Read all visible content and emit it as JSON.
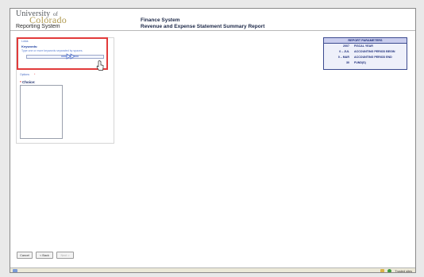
{
  "header": {
    "logo": {
      "university": "University",
      "of": "of",
      "colorado": "Colorado"
    },
    "subtitle": "Reporting System",
    "system_title": "Finance System",
    "report_title": "Revenue and Expense Statement Summary Report"
  },
  "prompt": {
    "top_link": "Lotus",
    "keywords_label": "Keywords:",
    "keywords_hint": "Type one or more keywords separated by spaces.",
    "keywords_value": "",
    "options_link": "Options",
    "choice_label": "Choice:",
    "required_marker": "*"
  },
  "report_parameters": {
    "title": "REPORT PARAMETERS",
    "rows": [
      {
        "value": "2007",
        "label": "FISCAL YEAR"
      },
      {
        "value": "0 – JUL",
        "label": "ACCOUNTING PERIOD BEGIN"
      },
      {
        "value": "0 – MAR",
        "label": "ACCOUNTING PERIOD END"
      },
      {
        "value": "30",
        "label": "FUND(S)"
      }
    ]
  },
  "footer": {
    "cancel": "Cancel",
    "back": "< Back",
    "next": "Next >"
  },
  "statusbar": {
    "zone": "Trusted sites"
  },
  "colors": {
    "highlight": "#e23a3a",
    "params_border": "#3b4a8f",
    "params_head_bg": "#c9cdee",
    "logo_gold": "#b09a50"
  }
}
